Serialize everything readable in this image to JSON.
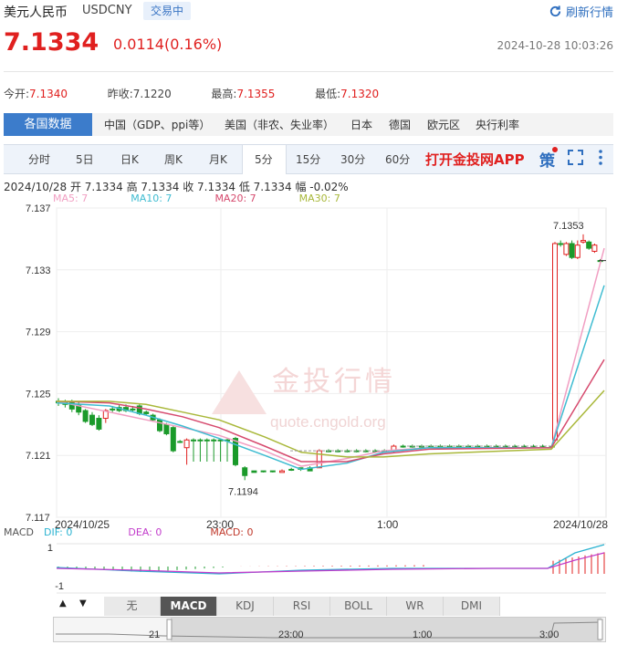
{
  "header": {
    "title": "美元人民币",
    "code": "USDCNY",
    "badge": "交易中",
    "refresh_label": "刷新行情",
    "price": "7.1334",
    "change": "0.0114(0.16%)",
    "datetime": "2024-10-28 10:03:26"
  },
  "quotes": [
    {
      "label": "今开:",
      "value": "7.1340"
    },
    {
      "label": "昨收:",
      "value": "7.1220"
    },
    {
      "label": "最高:",
      "value": "7.1355"
    },
    {
      "label": "最低:",
      "value": "7.1320"
    }
  ],
  "regions": {
    "active": "各国数据",
    "items": [
      "中国（GDP、ppi等）",
      "美国（非农、失业率）",
      "日本",
      "德国",
      "欧元区",
      "央行利率"
    ]
  },
  "periods": {
    "items": [
      "分时",
      "5日",
      "日K",
      "周K",
      "月K",
      "5分",
      "15分",
      "30分",
      "60分"
    ],
    "active": "5分",
    "app_link": "打开金投网APP",
    "strategy": "策"
  },
  "ohlc_line": "2024/10/28 开 7.1334 高 7.1334 收 7.1334 低 7.1334 幅 -0.02%",
  "ma_legend": [
    {
      "label": "MA5: 7",
      "color": "#f19ec2"
    },
    {
      "label": "MA10: 7",
      "color": "#3fbcd1"
    },
    {
      "label": "MA20: 7",
      "color": "#d64a6e"
    },
    {
      "label": "MA30: 7",
      "color": "#a9b83a"
    }
  ],
  "macd_legend": [
    {
      "label": "MACD",
      "color": "#555555"
    },
    {
      "label": "DIF: 0",
      "color": "#2bb3d1"
    },
    {
      "label": "DEA: 0",
      "color": "#c23ccb"
    },
    {
      "label": "MACD: 0",
      "color": "#c0392b"
    }
  ],
  "watermark": {
    "brand": "金投行情",
    "url": "quote.cngold.org"
  },
  "indicators": {
    "items": [
      "无",
      "MACD",
      "KDJ",
      "RSI",
      "BOLL",
      "WR",
      "DMI"
    ],
    "active": "MACD"
  },
  "navigator": {
    "labels": [
      "21",
      "23:00",
      "1:00",
      "3:00"
    ]
  },
  "chart_data": {
    "type": "candlestick",
    "y_ticks": [
      "7.137",
      "7.133",
      "7.129",
      "7.125",
      "7.121",
      "7.117"
    ],
    "ylim": [
      7.117,
      7.137
    ],
    "x_labels": [
      "2024/10/25",
      "23:00",
      "1:00",
      "2024/10/28"
    ],
    "annotations": [
      {
        "text": "7.1353",
        "value": 7.1353
      },
      {
        "text": "7.1194",
        "value": 7.1194
      }
    ],
    "candles": [
      {
        "o": 7.1245,
        "c": 7.1244,
        "h": 7.1247,
        "l": 7.1242,
        "up": false
      },
      {
        "o": 7.1244,
        "c": 7.1243,
        "h": 7.1246,
        "l": 7.1241,
        "up": false
      },
      {
        "o": 7.1244,
        "c": 7.124,
        "h": 7.1246,
        "l": 7.1238,
        "up": false
      },
      {
        "o": 7.1243,
        "c": 7.1238,
        "h": 7.1245,
        "l": 7.1236,
        "up": false
      },
      {
        "o": 7.1239,
        "c": 7.1232,
        "h": 7.124,
        "l": 7.1231,
        "up": false
      },
      {
        "o": 7.1236,
        "c": 7.123,
        "h": 7.1238,
        "l": 7.1229,
        "up": false
      },
      {
        "o": 7.1234,
        "c": 7.1227,
        "h": 7.1236,
        "l": 7.1226,
        "up": false
      },
      {
        "o": 7.1234,
        "c": 7.1239,
        "h": 7.124,
        "l": 7.1231,
        "up": true
      },
      {
        "o": 7.124,
        "c": 7.124,
        "h": 7.1242,
        "l": 7.1238,
        "up": false
      },
      {
        "o": 7.1241,
        "c": 7.1239,
        "h": 7.1243,
        "l": 7.1238,
        "up": false
      },
      {
        "o": 7.1241,
        "c": 7.1239,
        "h": 7.1243,
        "l": 7.1238,
        "up": false
      },
      {
        "o": 7.124,
        "c": 7.124,
        "h": 7.1242,
        "l": 7.1238,
        "up": false
      },
      {
        "o": 7.1242,
        "c": 7.1237,
        "h": 7.1243,
        "l": 7.1236,
        "up": false
      },
      {
        "o": 7.1238,
        "c": 7.1237,
        "h": 7.1239,
        "l": 7.1236,
        "up": false
      },
      {
        "o": 7.1236,
        "c": 7.1233,
        "h": 7.1237,
        "l": 7.1232,
        "up": false
      },
      {
        "o": 7.1233,
        "c": 7.1226,
        "h": 7.1234,
        "l": 7.1225,
        "up": false
      },
      {
        "o": 7.123,
        "c": 7.1224,
        "h": 7.1231,
        "l": 7.1223,
        "up": false
      },
      {
        "o": 7.1228,
        "c": 7.1213,
        "h": 7.1229,
        "l": 7.1212,
        "up": false
      },
      {
        "o": 7.1219,
        "c": 7.1219,
        "h": 7.122,
        "l": 7.1218,
        "up": false
      },
      {
        "o": 7.1215,
        "c": 7.122,
        "h": 7.1221,
        "l": 7.1204,
        "up": true
      },
      {
        "o": 7.122,
        "c": 7.122,
        "h": 7.1221,
        "l": 7.1206,
        "up": false
      },
      {
        "o": 7.122,
        "c": 7.122,
        "h": 7.1221,
        "l": 7.1206,
        "up": false
      },
      {
        "o": 7.122,
        "c": 7.122,
        "h": 7.1221,
        "l": 7.1206,
        "up": false
      },
      {
        "o": 7.122,
        "c": 7.122,
        "h": 7.1221,
        "l": 7.1206,
        "up": false
      },
      {
        "o": 7.122,
        "c": 7.122,
        "h": 7.1221,
        "l": 7.1206,
        "up": false
      },
      {
        "o": 7.122,
        "c": 7.122,
        "h": 7.1221,
        "l": 7.1206,
        "up": false
      },
      {
        "o": 7.1221,
        "c": 7.1204,
        "h": 7.1222,
        "l": 7.1203,
        "up": false
      },
      {
        "o": 7.1202,
        "c": 7.1197,
        "h": 7.1203,
        "l": 7.1194,
        "up": false
      },
      {
        "o": 7.12,
        "c": 7.1199,
        "h": 7.12,
        "l": 7.1199,
        "up": false
      },
      {
        "o": 7.12,
        "c": 7.12,
        "h": 7.12,
        "l": 7.1199,
        "up": false
      },
      {
        "o": 7.12,
        "c": 7.12,
        "h": 7.12,
        "l": 7.1199,
        "up": false
      },
      {
        "o": 7.1199,
        "c": 7.12,
        "h": 7.1201,
        "l": 7.1199,
        "up": true
      },
      {
        "o": 7.1201,
        "c": 7.1201,
        "h": 7.1202,
        "l": 7.12,
        "up": false
      },
      {
        "o": 7.1202,
        "c": 7.1201,
        "h": 7.1202,
        "l": 7.12,
        "up": false
      },
      {
        "o": 7.12,
        "c": 7.1202,
        "h": 7.1203,
        "l": 7.12,
        "up": false
      },
      {
        "o": 7.1202,
        "c": 7.1213,
        "h": 7.1214,
        "l": 7.1202,
        "up": true
      },
      {
        "o": 7.1213,
        "c": 7.1213,
        "h": 7.1214,
        "l": 7.1212,
        "up": false
      },
      {
        "o": 7.1213,
        "c": 7.1213,
        "h": 7.1214,
        "l": 7.1212,
        "up": false
      },
      {
        "o": 7.1213,
        "c": 7.1213,
        "h": 7.1214,
        "l": 7.1212,
        "up": false
      },
      {
        "o": 7.1213,
        "c": 7.1213,
        "h": 7.1214,
        "l": 7.1212,
        "up": false
      },
      {
        "o": 7.1213,
        "c": 7.1213,
        "h": 7.1214,
        "l": 7.1212,
        "up": false
      },
      {
        "o": 7.1213,
        "c": 7.1213,
        "h": 7.1214,
        "l": 7.1212,
        "up": false
      },
      {
        "o": 7.1213,
        "c": 7.1213,
        "h": 7.1214,
        "l": 7.1212,
        "up": false
      },
      {
        "o": 7.1213,
        "c": 7.1216,
        "h": 7.1217,
        "l": 7.1212,
        "up": true
      },
      {
        "o": 7.1216,
        "c": 7.1216,
        "h": 7.1217,
        "l": 7.1215,
        "up": false
      },
      {
        "o": 7.1216,
        "c": 7.1216,
        "h": 7.1217,
        "l": 7.1215,
        "up": false
      },
      {
        "o": 7.1216,
        "c": 7.1216,
        "h": 7.1217,
        "l": 7.1215,
        "up": false
      },
      {
        "o": 7.1216,
        "c": 7.1216,
        "h": 7.1217,
        "l": 7.1215,
        "up": false
      },
      {
        "o": 7.1216,
        "c": 7.1216,
        "h": 7.1217,
        "l": 7.1215,
        "up": false
      },
      {
        "o": 7.1216,
        "c": 7.1216,
        "h": 7.1217,
        "l": 7.1215,
        "up": false
      },
      {
        "o": 7.1216,
        "c": 7.1216,
        "h": 7.1217,
        "l": 7.1215,
        "up": false
      },
      {
        "o": 7.1216,
        "c": 7.1216,
        "h": 7.1217,
        "l": 7.1215,
        "up": false
      },
      {
        "o": 7.1216,
        "c": 7.1216,
        "h": 7.1217,
        "l": 7.1215,
        "up": false
      },
      {
        "o": 7.1216,
        "c": 7.1216,
        "h": 7.1217,
        "l": 7.1215,
        "up": false
      },
      {
        "o": 7.1216,
        "c": 7.1216,
        "h": 7.1217,
        "l": 7.1215,
        "up": false
      },
      {
        "o": 7.1216,
        "c": 7.1216,
        "h": 7.1217,
        "l": 7.1215,
        "up": false
      },
      {
        "o": 7.1216,
        "c": 7.1216,
        "h": 7.1217,
        "l": 7.1215,
        "up": false
      },
      {
        "o": 7.1216,
        "c": 7.1216,
        "h": 7.1217,
        "l": 7.1215,
        "up": false
      },
      {
        "o": 7.1216,
        "c": 7.1216,
        "h": 7.1217,
        "l": 7.1215,
        "up": false
      },
      {
        "o": 7.1216,
        "c": 7.1216,
        "h": 7.1217,
        "l": 7.1215,
        "up": false
      },
      {
        "o": 7.1216,
        "c": 7.1216,
        "h": 7.1217,
        "l": 7.1215,
        "up": false
      },
      {
        "o": 7.122,
        "c": 7.1347,
        "h": 7.1348,
        "l": 7.1219,
        "up": true
      },
      {
        "o": 7.1347,
        "c": 7.1347,
        "h": 7.1349,
        "l": 7.1345,
        "up": false
      },
      {
        "o": 7.1347,
        "c": 7.134,
        "h": 7.1348,
        "l": 7.1339,
        "up": true
      },
      {
        "o": 7.1347,
        "c": 7.1338,
        "h": 7.1349,
        "l": 7.1337,
        "up": false
      },
      {
        "o": 7.1346,
        "c": 7.1338,
        "h": 7.1349,
        "l": 7.1337,
        "up": true
      },
      {
        "o": 7.1349,
        "c": 7.1348,
        "h": 7.1353,
        "l": 7.1347,
        "up": true
      },
      {
        "o": 7.1348,
        "c": 7.1344,
        "h": 7.1349,
        "l": 7.1343,
        "up": false
      },
      {
        "o": 7.1342,
        "c": 7.1346,
        "h": 7.1347,
        "l": 7.1341,
        "up": true
      },
      {
        "o": 7.1336,
        "c": 7.1336,
        "h": 7.1337,
        "l": 7.1335,
        "up": false
      }
    ],
    "ma_series": [
      {
        "name": "MA5",
        "color": "#f19ec2",
        "values": [
          7.1245,
          7.1238,
          7.1233,
          7.1228,
          7.1223,
          7.1213,
          7.1203,
          7.1208,
          7.1213,
          7.1215,
          7.1215,
          7.1344
        ]
      },
      {
        "name": "MA10",
        "color": "#3fbcd1",
        "values": [
          7.1244,
          7.1242,
          7.1236,
          7.1229,
          7.1221,
          7.121,
          7.1201,
          7.1205,
          7.1212,
          7.1215,
          7.1215,
          7.132
        ]
      },
      {
        "name": "MA20",
        "color": "#d64a6e",
        "values": [
          7.1245,
          7.1244,
          7.124,
          7.1235,
          7.1228,
          7.1216,
          7.1206,
          7.1206,
          7.1211,
          7.1214,
          7.1215,
          7.1272
        ]
      },
      {
        "name": "MA30",
        "color": "#a9b83a",
        "values": [
          7.1245,
          7.1245,
          7.1243,
          7.1238,
          7.1233,
          7.1222,
          7.1212,
          7.1209,
          7.1209,
          7.1211,
          7.1214,
          7.1252
        ]
      }
    ],
    "macd_ticks": [
      "1",
      "-1"
    ]
  }
}
